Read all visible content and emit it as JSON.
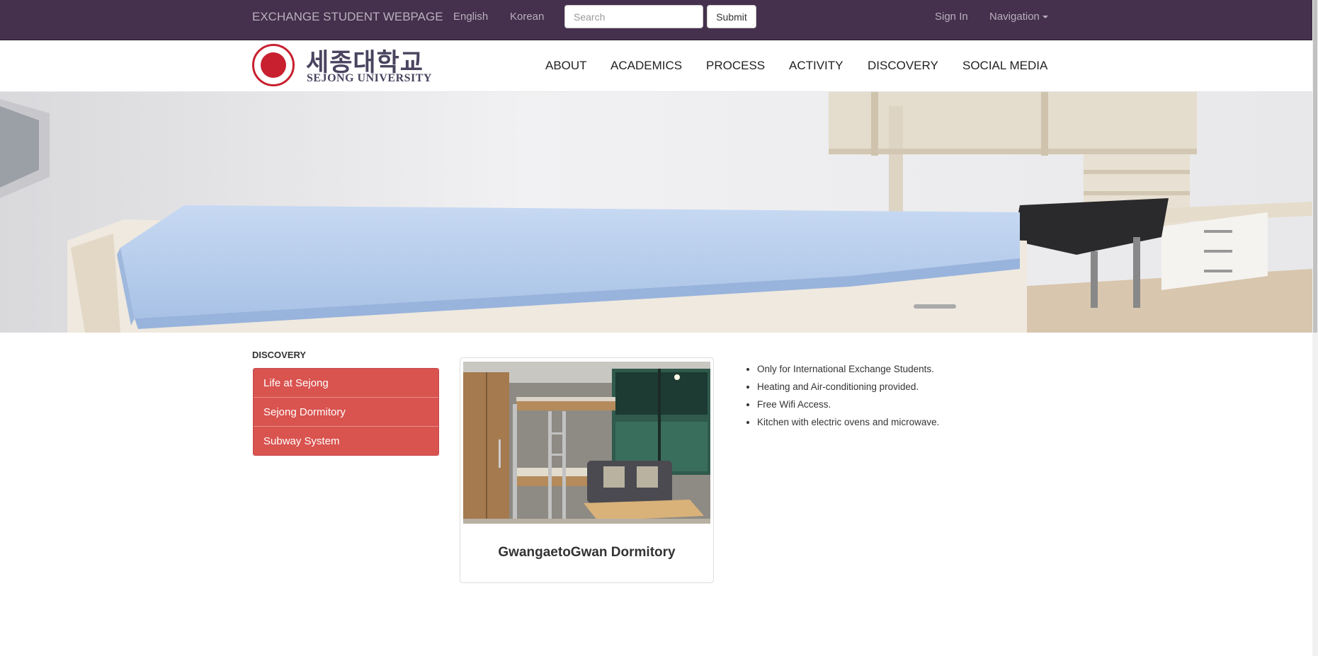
{
  "topbar": {
    "brand": "EXCHANGE STUDENT WEBPAGE",
    "lang_english": "English",
    "lang_korean": "Korean",
    "search_placeholder": "Search",
    "submit_label": "Submit",
    "sign_in": "Sign In",
    "navigation": "Navigation"
  },
  "logo": {
    "korean": "세종대학교",
    "english": "SEJONG UNIVERSITY"
  },
  "menu": [
    "ABOUT",
    "ACADEMICS",
    "PROCESS",
    "ACTIVITY",
    "DISCOVERY",
    "SOCIAL MEDIA"
  ],
  "sidebar": {
    "title": "DISCOVERY",
    "items": [
      "Life at Sejong",
      "Sejong Dormitory",
      "Subway System"
    ]
  },
  "card": {
    "caption": "GwangaetoGwan Dormitory"
  },
  "features": [
    "Only for International Exchange Students.",
    "Heating and Air-conditioning provided.",
    "Free Wifi Access.",
    "Kitchen with electric ovens and microwave."
  ],
  "colors": {
    "topbar": "#45304d",
    "sidebar_item": "#d9534f"
  }
}
